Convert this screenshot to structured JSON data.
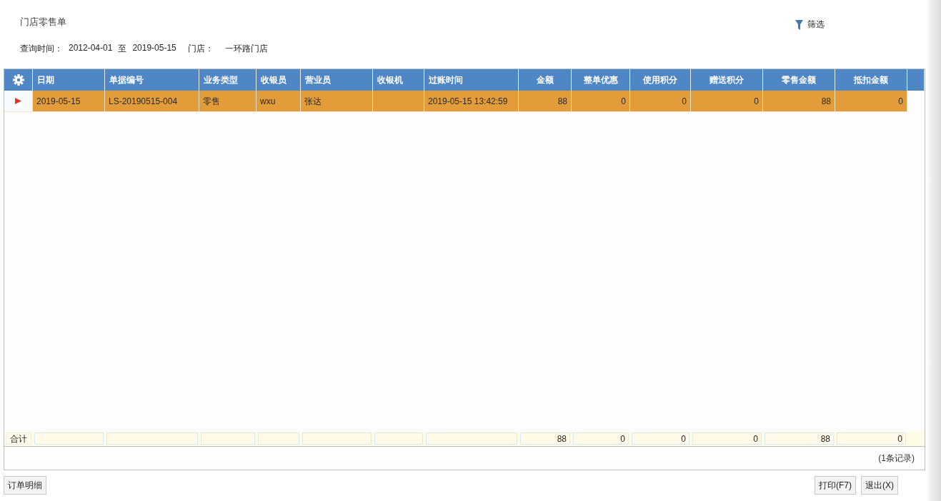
{
  "title": "门店零售单",
  "filter": {
    "label": "筛选"
  },
  "query": {
    "time_label": "查询时间：",
    "start": "2012-04-01",
    "to": "至",
    "end": "2019-05-15",
    "store_label": "门店：",
    "store": "一环路门店"
  },
  "table": {
    "columns": [
      {
        "label": "日期",
        "kind": "text"
      },
      {
        "label": "单据编号",
        "kind": "text"
      },
      {
        "label": "业务类型",
        "kind": "text"
      },
      {
        "label": "收银员",
        "kind": "text"
      },
      {
        "label": "营业员",
        "kind": "text"
      },
      {
        "label": "收银机",
        "kind": "text"
      },
      {
        "label": "过账时间",
        "kind": "text"
      },
      {
        "label": "金额",
        "kind": "number"
      },
      {
        "label": "整单优惠",
        "kind": "number"
      },
      {
        "label": "使用积分",
        "kind": "number"
      },
      {
        "label": "赠送积分",
        "kind": "number"
      },
      {
        "label": "零售金额",
        "kind": "number"
      },
      {
        "label": "抵扣金额",
        "kind": "number"
      }
    ],
    "rows": [
      {
        "selected": true,
        "cells": [
          "2019-05-15",
          "LS-20190515-004",
          "零售",
          "wxu",
          "张达",
          null,
          "2019-05-15 13:42:59",
          "88",
          "0",
          "0",
          "0",
          "88",
          "0"
        ]
      }
    ],
    "totals": {
      "label": "合计",
      "cells": [
        null,
        null,
        null,
        null,
        null,
        null,
        null,
        "88",
        "0",
        "0",
        "0",
        "88",
        "0"
      ]
    },
    "record_count": "(1条记录)"
  },
  "buttons_left": [
    "订单明细"
  ],
  "buttons_right": [
    "打印(F7)",
    "退出(X)"
  ]
}
